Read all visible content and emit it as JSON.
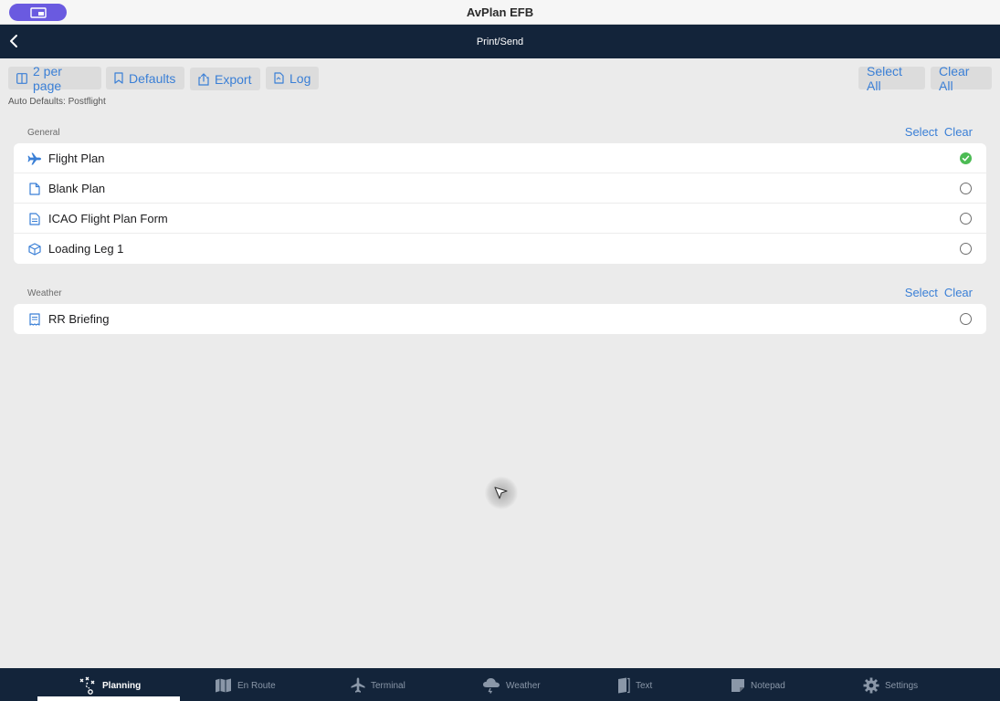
{
  "window": {
    "title": "AvPlan EFB"
  },
  "nav": {
    "title": "Print/Send"
  },
  "toolbar": {
    "per_page_label": "2 per page",
    "defaults_label": "Defaults",
    "export_label": "Export",
    "log_label": "Log",
    "select_all_label": "Select All",
    "clear_all_label": "Clear All"
  },
  "auto_defaults": "Auto Defaults: Postflight",
  "sections": [
    {
      "label": "General",
      "select_label": "Select",
      "clear_label": "Clear",
      "items": [
        {
          "label": "Flight Plan",
          "icon": "airplane-icon",
          "checked": true
        },
        {
          "label": "Blank Plan",
          "icon": "document-icon",
          "checked": false
        },
        {
          "label": "ICAO Flight Plan Form",
          "icon": "document-text-icon",
          "checked": false
        },
        {
          "label": "Loading Leg 1",
          "icon": "box-icon",
          "checked": false
        }
      ]
    },
    {
      "label": "Weather",
      "select_label": "Select",
      "clear_label": "Clear",
      "items": [
        {
          "label": "RR Briefing",
          "icon": "receipt-icon",
          "checked": false
        }
      ]
    }
  ],
  "tabs": [
    {
      "label": "Planning",
      "icon": "planning-icon",
      "active": true
    },
    {
      "label": "En Route",
      "icon": "map-icon",
      "active": false
    },
    {
      "label": "Terminal",
      "icon": "airplane-icon",
      "active": false
    },
    {
      "label": "Weather",
      "icon": "cloud-icon",
      "active": false
    },
    {
      "label": "Text",
      "icon": "book-icon",
      "active": false
    },
    {
      "label": "Notepad",
      "icon": "notepad-icon",
      "active": false
    },
    {
      "label": "Settings",
      "icon": "gear-icon",
      "active": false
    }
  ],
  "colors": {
    "accent": "#3a7fd6",
    "navbar": "#13243a",
    "checked": "#4cbb54",
    "pill": "#6a5ae0"
  }
}
